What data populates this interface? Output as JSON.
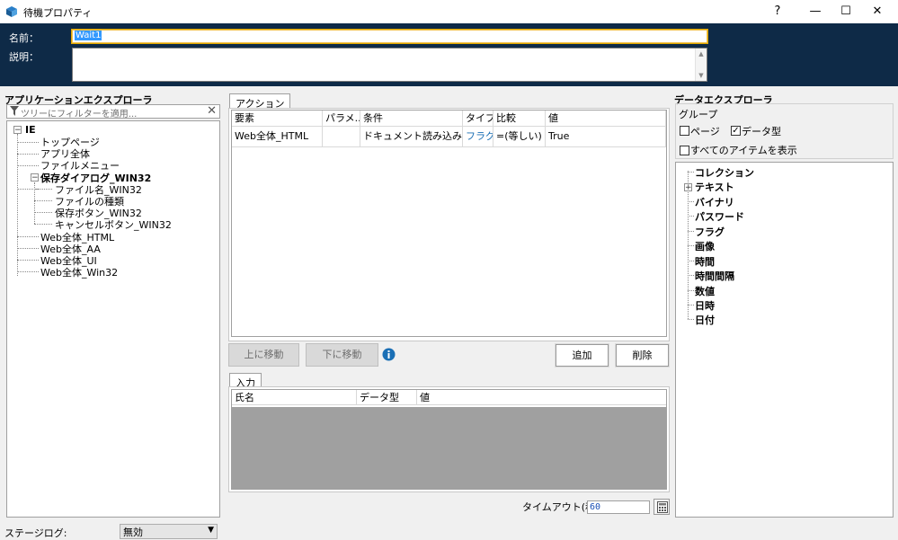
{
  "window": {
    "title": "待機プロパティ",
    "help": "?",
    "minimize": "—",
    "maximize": "☐",
    "close": "✕"
  },
  "header": {
    "name_label": "名前：",
    "name_value": "Wait1",
    "desc_label": "説明：",
    "desc_value": ""
  },
  "app_explorer": {
    "title": "アプリケーションエクスプローラ",
    "filter_placeholder": "ツリーにフィルターを適用...",
    "root": "IE",
    "items": [
      "トップページ",
      "アプリ全体",
      "ファイルメニュー",
      "保存ダイアログ_WIN32",
      "ファイル名_WIN32",
      "ファイルの種類",
      "保存ボタン_WIN32",
      "キャンセルボタン_WIN32",
      "Web全体_HTML",
      "Web全体_AA",
      "Web全体_UI",
      "Web全体_Win32"
    ]
  },
  "actions": {
    "tab": "アクション",
    "columns": [
      "要素",
      "パラメ...",
      "条件",
      "タイプ",
      "比較",
      "値"
    ],
    "rows": [
      {
        "element": "Web全体_HTML",
        "param": "",
        "condition": "ドキュメント読み込み完了",
        "type": "フラグ",
        "compare": "=(等しい)",
        "value": "True"
      }
    ],
    "move_up": "上に移動",
    "move_down": "下に移動",
    "add": "追加",
    "delete": "削除",
    "type_color": "#1a6fb5"
  },
  "inputs": {
    "tab": "入力",
    "columns": [
      "氏名",
      "データ型",
      "値"
    ]
  },
  "timeout": {
    "label": "タイムアウト(秒):",
    "value": "60"
  },
  "stage_log": {
    "label": "ステージログ:",
    "value": "無効"
  },
  "data_explorer": {
    "title": "データエクスプローラ",
    "group_label": "グループ",
    "page_label": "ページ",
    "page_checked": false,
    "datatype_label": "データ型",
    "datatype_checked": true,
    "show_all_label": "すべてのアイテムを表示",
    "show_all_checked": false,
    "items": [
      "コレクション",
      "テキスト",
      "バイナリ",
      "パスワード",
      "フラグ",
      "画像",
      "時間",
      "時間間隔",
      "数値",
      "日時",
      "日付"
    ]
  },
  "colors": {
    "header_bg": "#0e2a47",
    "grid_empty": "#a0a0a0",
    "info_icon": "#1a6fb5"
  }
}
